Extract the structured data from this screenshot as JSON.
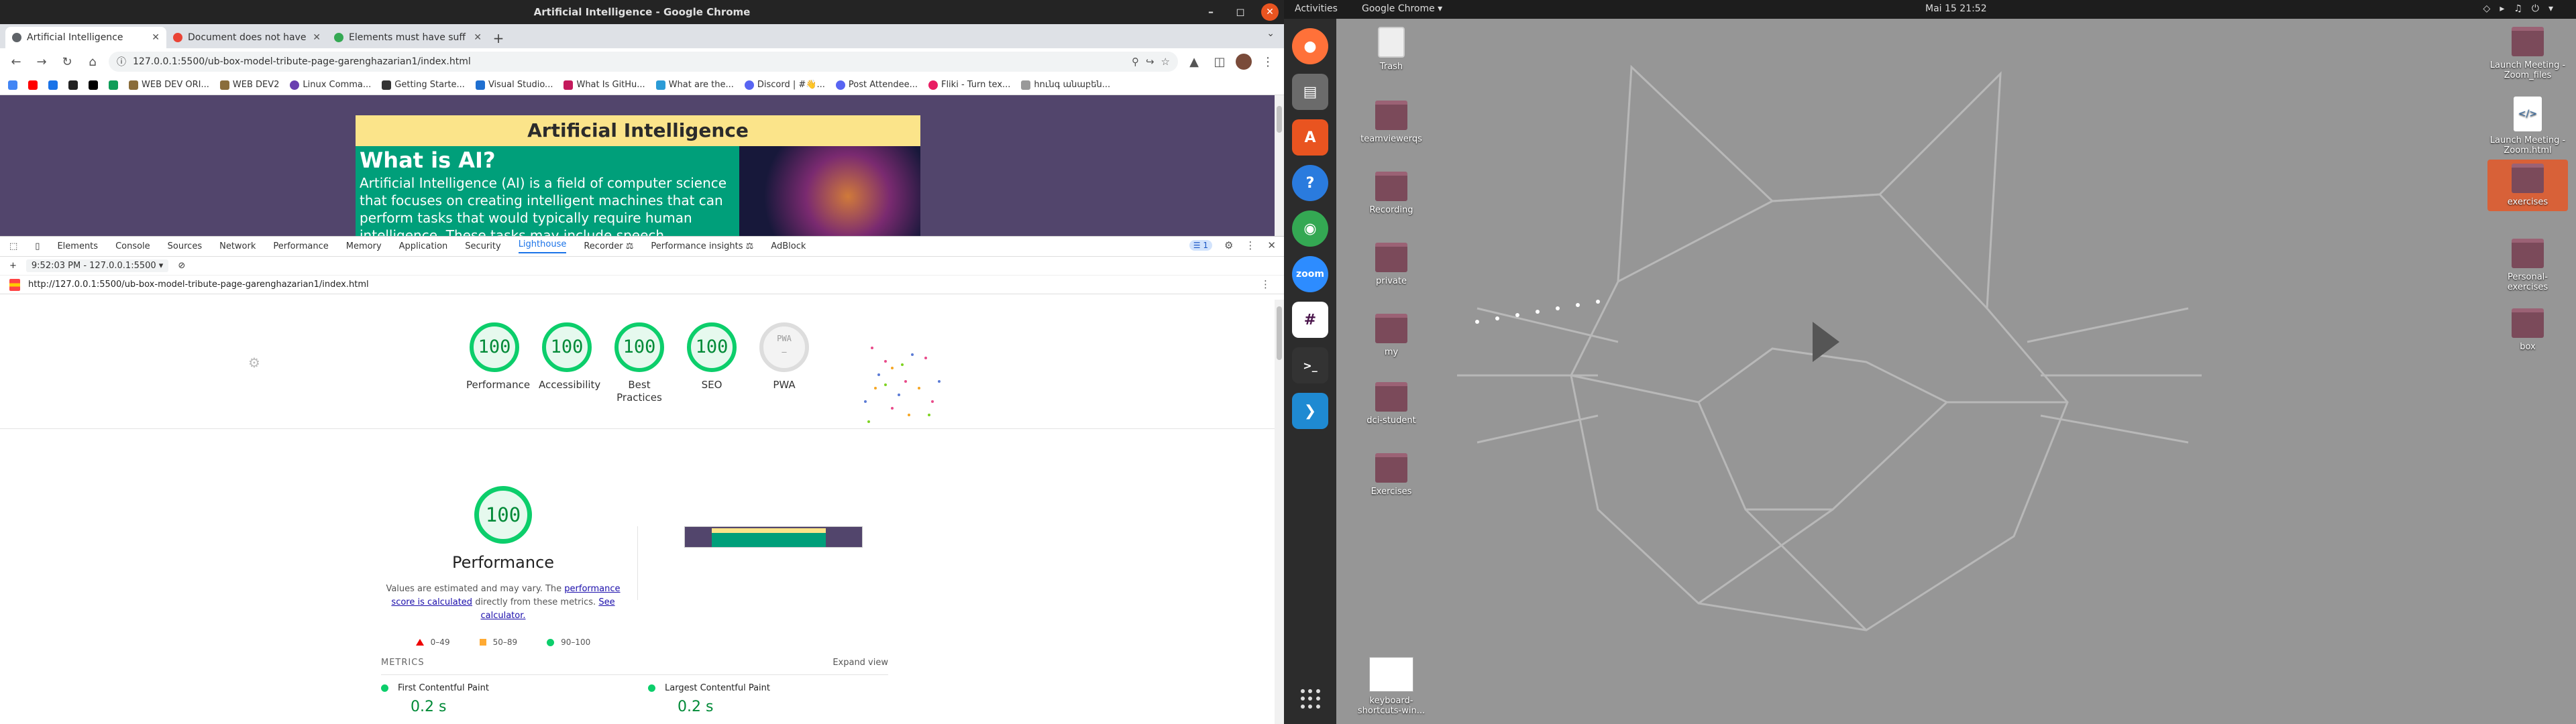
{
  "window": {
    "title": "Artificial Intelligence - Google Chrome"
  },
  "tabs": [
    {
      "label": "Artificial Intelligence",
      "color": "#5f6368",
      "active": true
    },
    {
      "label": "Document does not have",
      "color": "#ea4335",
      "active": false
    },
    {
      "label": "Elements must have suff",
      "color": "#34a853",
      "active": false
    }
  ],
  "address": {
    "url": "127.0.0.1:5500/ub-box-model-tribute-page-garenghazarian1/index.html"
  },
  "bookmarks": [
    {
      "label": "WEB DEV ORI...",
      "color": "#8a6d3b"
    },
    {
      "label": "WEB DEV2",
      "color": "#8a6d3b"
    },
    {
      "label": "Linux Comma...",
      "color": "#6a3fb0"
    },
    {
      "label": "Getting Starte...",
      "color": "#333"
    },
    {
      "label": "Visual Studio...",
      "color": "#1f6fd0"
    },
    {
      "label": "What Is GitHu...",
      "color": "#c41a5c"
    },
    {
      "label": "What are the...",
      "color": "#2b9bd6"
    },
    {
      "label": "Discord | #👋...",
      "color": "#5865f2"
    },
    {
      "label": "Post Attendee...",
      "color": "#5865f2"
    },
    {
      "label": "Fliki - Turn tex...",
      "color": "#e91e63"
    },
    {
      "label": "հունգ անաբեն...",
      "color": "#999"
    }
  ],
  "page": {
    "heading": "Artificial Intelligence",
    "subheading": "What is AI?",
    "paragraph": "Artificial Intelligence (AI) is a field of computer science that focuses on creating intelligent machines that can perform tasks that would typically require human intelligence. These tasks may include speech recognition, decision-"
  },
  "devtools": {
    "tabs": [
      "Elements",
      "Console",
      "Sources",
      "Network",
      "Performance",
      "Memory",
      "Application",
      "Security",
      "Lighthouse",
      "Recorder ⚖",
      "Performance insights ⚖",
      "AdBlock"
    ],
    "active_tab": "Lighthouse",
    "issues_badge": "1",
    "run_select": "9:52:03 PM - 127.0.0.1:5500",
    "report_url": "http://127.0.0.1:5500/ub-box-model-tribute-page-garenghazarian1/index.html"
  },
  "scores": [
    {
      "label": "Performance",
      "value": "100"
    },
    {
      "label": "Accessibility",
      "value": "100"
    },
    {
      "label": "Best Practices",
      "value": "100"
    },
    {
      "label": "SEO",
      "value": "100"
    },
    {
      "label": "PWA",
      "value": "PWA"
    }
  ],
  "perf": {
    "score": "100",
    "title": "Performance",
    "desc_pre": "Values are estimated and may vary. The",
    "link1": "performance score is calculated",
    "desc_mid": "directly from these metrics.",
    "link2": "See calculator.",
    "legend": [
      "0–49",
      "50–89",
      "90–100"
    ]
  },
  "metrics": {
    "header": "METRICS",
    "expand": "Expand view",
    "items": [
      {
        "name": "First Contentful Paint",
        "value": "0.2 s"
      },
      {
        "name": "Largest Contentful Paint",
        "value": "0.2 s"
      }
    ]
  },
  "desktop": {
    "activities": "Activities",
    "app_menu": "Google Chrome ▾",
    "clock": "Mai 15  21:52",
    "icons": [
      {
        "label": "Trash",
        "kind": "trash"
      },
      {
        "label": "teamviewerqs",
        "kind": "folder"
      },
      {
        "label": "Recording",
        "kind": "folder"
      },
      {
        "label": "private",
        "kind": "folder"
      },
      {
        "label": "my",
        "kind": "folder"
      },
      {
        "label": "dci-student",
        "kind": "folder"
      },
      {
        "label": "Exercises",
        "kind": "folder"
      },
      {
        "label": "keyboard-shortcuts-win...",
        "kind": "doc"
      },
      {
        "label": "Launch Meeting - Zoom_files",
        "kind": "folder"
      },
      {
        "label": "Launch Meeting - Zoom.html",
        "kind": "html"
      },
      {
        "label": "exercises",
        "kind": "folder"
      },
      {
        "label": "Personal-exercises",
        "kind": "folder"
      },
      {
        "label": "box",
        "kind": "folder"
      }
    ]
  },
  "dock": [
    {
      "name": "firefox",
      "color": "#ff7139",
      "glyph": "●"
    },
    {
      "name": "files",
      "color": "#6b6b6b",
      "glyph": "▤"
    },
    {
      "name": "software",
      "color": "#e95420",
      "glyph": "A"
    },
    {
      "name": "help",
      "color": "#2a7bde",
      "glyph": "?"
    },
    {
      "name": "chrome",
      "color": "#34a853",
      "glyph": "◉"
    },
    {
      "name": "zoom",
      "color": "#2d8cff",
      "glyph": "z"
    },
    {
      "name": "slack",
      "color": "#4a154b",
      "glyph": "#"
    },
    {
      "name": "terminal",
      "color": "#333",
      "glyph": ">_"
    },
    {
      "name": "vscode",
      "color": "#1f8ad2",
      "glyph": "❯"
    }
  ]
}
